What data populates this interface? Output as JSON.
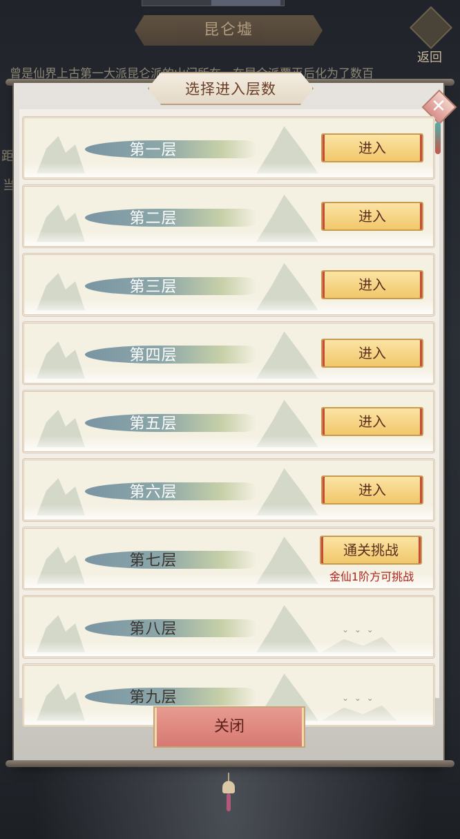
{
  "background": {
    "location_title": "昆仑墟",
    "back_label": "返回",
    "description": "曾是仙界上古第一大派昆仑派的山门所在，在昆仑派覆灭后化为了数百",
    "side_chars": [
      "距",
      "当"
    ]
  },
  "dialog": {
    "title": "选择进入层数",
    "close_label": "关闭",
    "levels": [
      {
        "name": "第一层",
        "action": "进入"
      },
      {
        "name": "第二层",
        "action": "进入"
      },
      {
        "name": "第三层",
        "action": "进入"
      },
      {
        "name": "第四层",
        "action": "进入"
      },
      {
        "name": "第五层",
        "action": "进入"
      },
      {
        "name": "第六层",
        "action": "进入"
      },
      {
        "name": "第七层",
        "action": "通关挑战",
        "requirement": "金仙1阶方可挑战"
      },
      {
        "name": "第八层"
      },
      {
        "name": "第九层"
      }
    ]
  },
  "colors": {
    "enter_button": "#f1c76b",
    "close_button": "#d67a72",
    "requirement_text": "#b0221c"
  }
}
